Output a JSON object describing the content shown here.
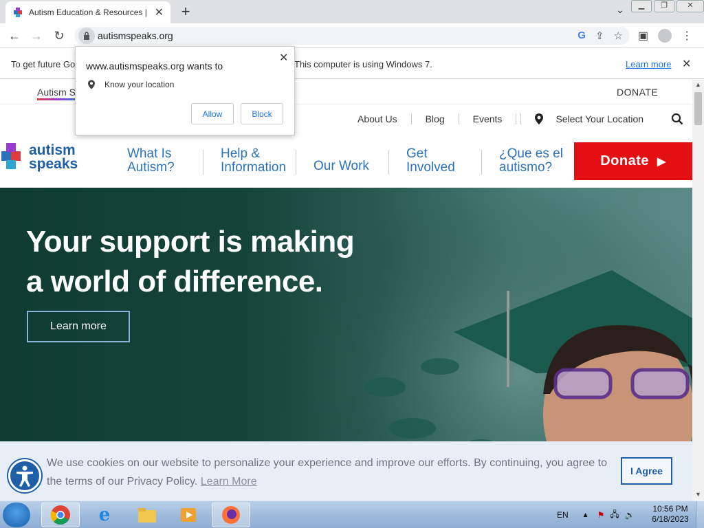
{
  "browser": {
    "tab_title": "Autism Education & Resources |",
    "url": "autismspeaks.org",
    "infobar_text_left": "To get future Go",
    "infobar_text_right": "This computer is using Windows 7.",
    "infobar_link": "Learn more"
  },
  "permission_popup": {
    "title": "www.autismspeaks.org wants to",
    "permission": "Know your location",
    "allow_label": "Allow",
    "block_label": "Block"
  },
  "site": {
    "brand_tab": "Autism S",
    "donate_top": "DONATE",
    "util_nav": [
      "About Us",
      "Blog",
      "Events"
    ],
    "location_label": "Select Your Location",
    "logo_line1": "autism",
    "logo_line2": "speaks",
    "main_nav": [
      {
        "line1": "What Is",
        "line2": "Autism?"
      },
      {
        "line1": "Help &",
        "line2": "Information"
      },
      {
        "line1": "Our Work",
        "line2": ""
      },
      {
        "line1": "Get",
        "line2": "Involved"
      },
      {
        "line1": "¿Que es el",
        "line2": "autismo?"
      }
    ],
    "donate_button": "Donate",
    "hero_title_line1": "Your support is making",
    "hero_title_line2": "a world of difference.",
    "hero_button": "Learn more"
  },
  "cookie_banner": {
    "text": "We use cookies on our website to personalize your experience and improve our efforts. By continuing, you agree to the terms of our Privacy Policy.",
    "learn_more": "Learn More",
    "agree_label": "I Agree"
  },
  "taskbar": {
    "language": "EN",
    "time": "10:56 PM",
    "date": "6/18/2023"
  },
  "colors": {
    "brand_blue": "#1e5fa8",
    "donate_red": "#e30f13",
    "hero_green": "#103c32"
  }
}
